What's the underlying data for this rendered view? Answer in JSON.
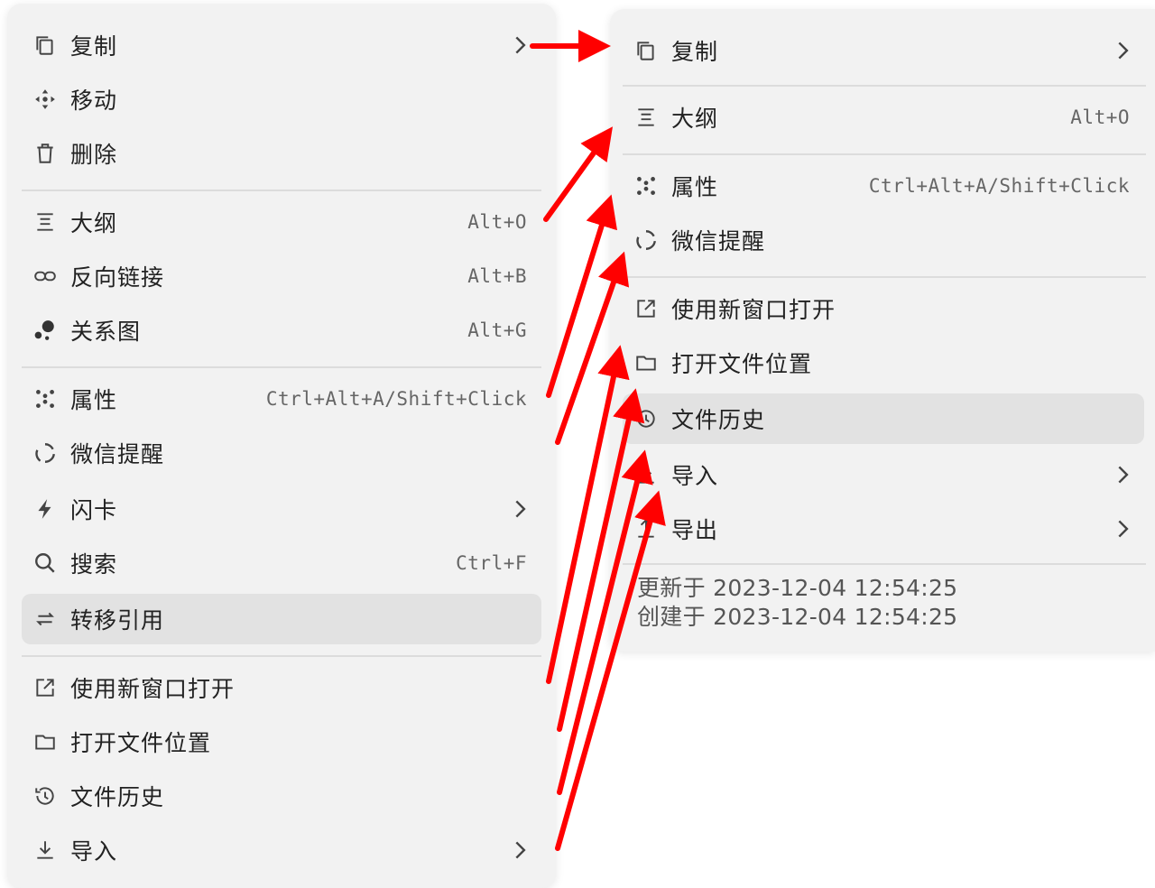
{
  "left_menu": {
    "items": [
      {
        "label": "复制",
        "icon": "copy-icon",
        "submenu": true
      },
      {
        "label": "移动",
        "icon": "move-icon"
      },
      {
        "label": "删除",
        "icon": "trash-icon"
      },
      {
        "label": "大纲",
        "icon": "outline-icon",
        "shortcut": "Alt+O"
      },
      {
        "label": "反向链接",
        "icon": "link-icon",
        "shortcut": "Alt+B"
      },
      {
        "label": "关系图",
        "icon": "graph-icon",
        "shortcut": "Alt+G"
      },
      {
        "label": "属性",
        "icon": "attributes-icon",
        "shortcut": "Ctrl+Alt+A/Shift+Click"
      },
      {
        "label": "微信提醒",
        "icon": "wechat-reminder-icon"
      },
      {
        "label": "闪卡",
        "icon": "flashcard-icon",
        "submenu": true
      },
      {
        "label": "搜索",
        "icon": "search-icon",
        "shortcut": "Ctrl+F"
      },
      {
        "label": "转移引用",
        "icon": "transfer-icon",
        "highlighted": true
      },
      {
        "label": "使用新窗口打开",
        "icon": "open-window-icon"
      },
      {
        "label": "打开文件位置",
        "icon": "folder-icon"
      },
      {
        "label": "文件历史",
        "icon": "history-icon"
      },
      {
        "label": "导入",
        "icon": "import-icon",
        "submenu": true
      }
    ]
  },
  "right_menu": {
    "items": [
      {
        "label": "复制",
        "icon": "copy-icon",
        "submenu": true
      },
      {
        "label": "大纲",
        "icon": "outline-icon",
        "shortcut": "Alt+O"
      },
      {
        "label": "属性",
        "icon": "attributes-icon",
        "shortcut": "Ctrl+Alt+A/Shift+Click"
      },
      {
        "label": "微信提醒",
        "icon": "wechat-reminder-icon"
      },
      {
        "label": "使用新窗口打开",
        "icon": "open-window-icon"
      },
      {
        "label": "打开文件位置",
        "icon": "folder-icon"
      },
      {
        "label": "文件历史",
        "icon": "history-icon",
        "highlighted": true
      },
      {
        "label": "导入",
        "icon": "import-icon",
        "submenu": true
      },
      {
        "label": "导出",
        "icon": "export-icon",
        "submenu": true
      }
    ],
    "footer": {
      "updated": "更新于 2023-12-04 12:54:25",
      "created": "创建于 2023-12-04 12:54:25"
    }
  },
  "colors": {
    "menu_bg": "#f2f2f2",
    "highlight_bg": "#e2e2e2",
    "annotation_arrow": "#ff0000"
  }
}
